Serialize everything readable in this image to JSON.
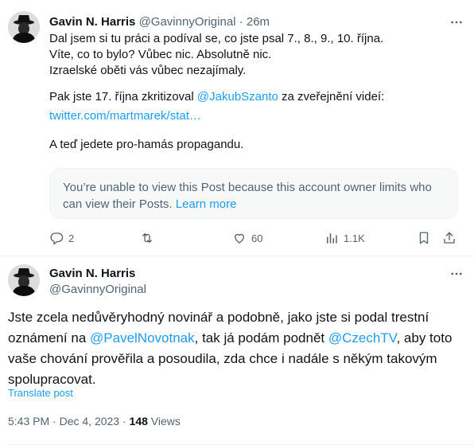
{
  "reply": {
    "author_name": "Gavin N. Harris",
    "author_handle": "@GavinnyOriginal",
    "separator": "·",
    "time": "26m",
    "lines": [
      "Dal jsem si tu práci a podíval se, co jste psal 7., 8., 9., 10. října.",
      "Víte, co to bylo? Vůbec nic. Absolutně nic.",
      "Izraelské oběti vás vůbec nezajímaly."
    ],
    "line4_pre": "Pak jste 17. října zkritizoval ",
    "line4_mention": "@JakubSzanto",
    "line4_post": " za zveřejnění videí:",
    "link": "twitter.com/martmarek/stat…",
    "line6": "A teď jedete pro-hamás propagandu.",
    "quote_text": "You’re unable to view this Post because this account owner limits who can view their Posts.",
    "quote_link": "Learn more",
    "actions": {
      "replies": "2",
      "retweets": "",
      "likes": "60",
      "views": "1.1K"
    }
  },
  "main": {
    "author_name": "Gavin N. Harris",
    "author_handle": "@GavinnyOriginal",
    "text_pre": "Jste zcela nedůvěryhodný novinář a podobně, jako jste si podal trestní oznámení na ",
    "mention1": "@PavelNovotnak",
    "text_mid": ", tak já podám podnět ",
    "mention2": "@CzechTV",
    "text_post": ", aby toto vaše chování prověřila a posoudila, zda chce i nadále s někým takovým spolupracovat.",
    "translate": "Translate post",
    "time": "5:43 PM",
    "separator": "·",
    "date": "Dec 4, 2023",
    "views_count": "148",
    "views_label": "Views"
  },
  "colors": {
    "accent": "#1d9bf0",
    "text": "#0f1419",
    "muted": "#536471",
    "border": "#eff3f4"
  },
  "icons": [
    "avatar-icon",
    "more-icon",
    "reply-icon",
    "retweet-icon",
    "like-icon",
    "views-icon",
    "bookmark-icon",
    "share-icon"
  ]
}
